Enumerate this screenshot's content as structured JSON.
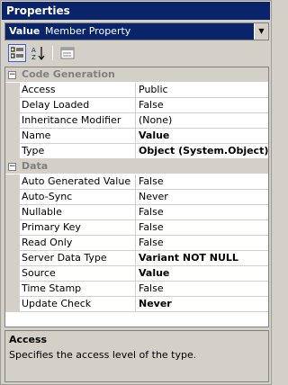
{
  "window": {
    "title": "Properties"
  },
  "selector": {
    "name": "Value",
    "type": "Member Property"
  },
  "categories": [
    {
      "label": "Code Generation",
      "properties": [
        {
          "name": "Access",
          "value": "Public",
          "bold": false
        },
        {
          "name": "Delay Loaded",
          "value": "False",
          "bold": false
        },
        {
          "name": "Inheritance Modifier",
          "value": "(None)",
          "bold": false
        },
        {
          "name": "Name",
          "value": "Value",
          "bold": true
        },
        {
          "name": "Type",
          "value": "Object (System.Object)",
          "bold": true
        }
      ]
    },
    {
      "label": "Data",
      "properties": [
        {
          "name": "Auto Generated Value",
          "value": "False",
          "bold": false
        },
        {
          "name": "Auto-Sync",
          "value": "Never",
          "bold": false
        },
        {
          "name": "Nullable",
          "value": "False",
          "bold": false
        },
        {
          "name": "Primary Key",
          "value": "False",
          "bold": false
        },
        {
          "name": "Read Only",
          "value": "False",
          "bold": false
        },
        {
          "name": "Server Data Type",
          "value": "Variant NOT NULL",
          "bold": true
        },
        {
          "name": "Source",
          "value": "Value",
          "bold": true
        },
        {
          "name": "Time Stamp",
          "value": "False",
          "bold": false
        },
        {
          "name": "Update Check",
          "value": "Never",
          "bold": true
        }
      ]
    }
  ],
  "description": {
    "title": "Access",
    "text": "Specifies the access level of the type."
  }
}
